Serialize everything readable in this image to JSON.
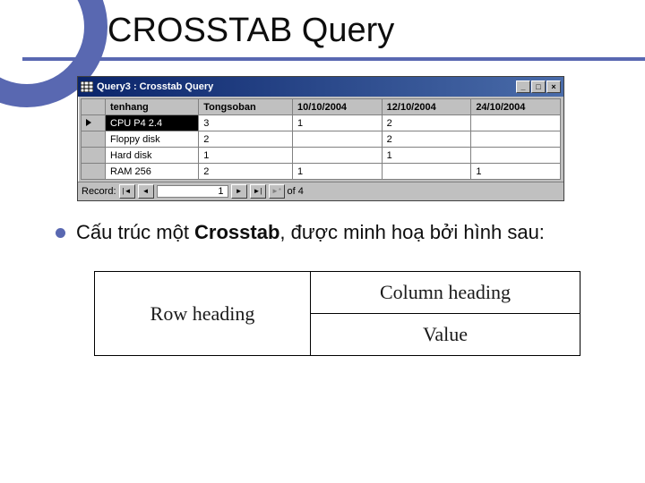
{
  "title": "CROSSTAB Query",
  "window": {
    "title": "Query3 : Crosstab Query",
    "min_label": "_",
    "max_label": "□",
    "close_label": "×",
    "columns": [
      "tenhang",
      "Tongsoban",
      "10/10/2004",
      "12/10/2004",
      "24/10/2004"
    ],
    "rows": [
      {
        "pointer": true,
        "cells": [
          "CPU P4 2.4",
          "3",
          "1",
          "2",
          ""
        ],
        "selected_col": 0
      },
      {
        "pointer": false,
        "cells": [
          "Floppy disk",
          "2",
          "",
          "2",
          ""
        ]
      },
      {
        "pointer": false,
        "cells": [
          "Hard disk",
          "1",
          "",
          "1",
          ""
        ]
      },
      {
        "pointer": false,
        "cells": [
          "RAM 256",
          "2",
          "1",
          "",
          "1"
        ]
      }
    ],
    "nav": {
      "record_label": "Record:",
      "first": "|◄",
      "prev": "◄",
      "current": "1",
      "next": "►",
      "last": "►|",
      "new": "►*",
      "of_text": "of  4"
    }
  },
  "bullet": {
    "before": "Cấu trúc một ",
    "bold": "Crosstab",
    "after": ", được minh hoạ bởi hình sau:"
  },
  "diagram": {
    "row_heading": "Row heading",
    "column_heading": "Column heading",
    "value": "Value"
  }
}
